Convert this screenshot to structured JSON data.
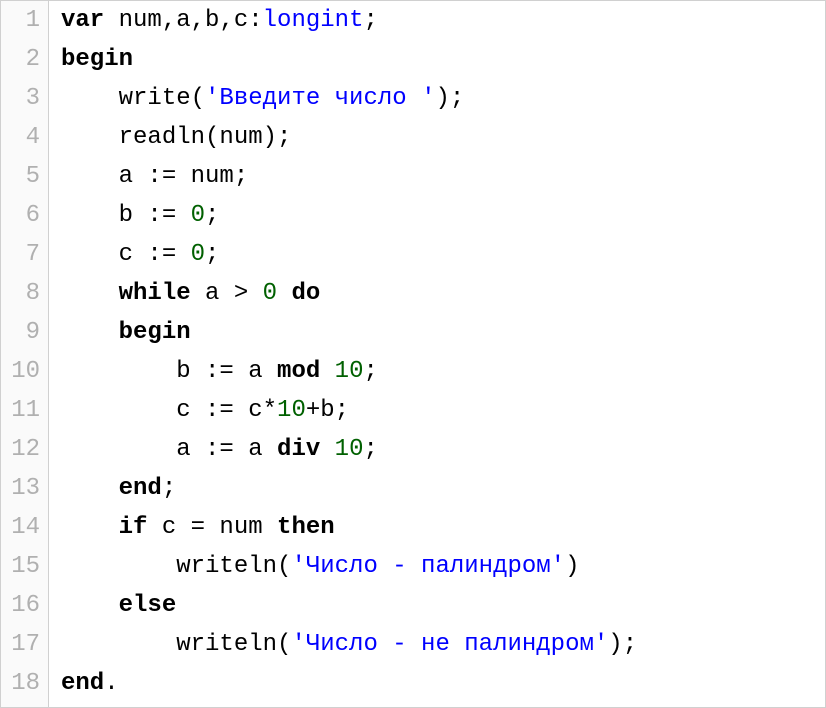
{
  "code": {
    "lines": [
      {
        "n": "1",
        "tokens": [
          {
            "cls": "kw",
            "t": "var"
          },
          {
            "cls": "pn",
            "t": " num,a,b,c:"
          },
          {
            "cls": "type",
            "t": "longint"
          },
          {
            "cls": "pn",
            "t": ";"
          }
        ],
        "indent": 0
      },
      {
        "n": "2",
        "tokens": [
          {
            "cls": "kw",
            "t": "begin"
          }
        ],
        "indent": 0
      },
      {
        "n": "3",
        "tokens": [
          {
            "cls": "pn",
            "t": "write("
          },
          {
            "cls": "str",
            "t": "'Введите число '"
          },
          {
            "cls": "pn",
            "t": ");"
          }
        ],
        "indent": 2
      },
      {
        "n": "4",
        "tokens": [
          {
            "cls": "pn",
            "t": "readln(num);"
          }
        ],
        "indent": 2
      },
      {
        "n": "5",
        "tokens": [
          {
            "cls": "pn",
            "t": "a := num;"
          }
        ],
        "indent": 2
      },
      {
        "n": "6",
        "tokens": [
          {
            "cls": "pn",
            "t": "b := "
          },
          {
            "cls": "num",
            "t": "0"
          },
          {
            "cls": "pn",
            "t": ";"
          }
        ],
        "indent": 2
      },
      {
        "n": "7",
        "tokens": [
          {
            "cls": "pn",
            "t": "c := "
          },
          {
            "cls": "num",
            "t": "0"
          },
          {
            "cls": "pn",
            "t": ";"
          }
        ],
        "indent": 2
      },
      {
        "n": "8",
        "tokens": [
          {
            "cls": "kw",
            "t": "while"
          },
          {
            "cls": "pn",
            "t": " a > "
          },
          {
            "cls": "num",
            "t": "0"
          },
          {
            "cls": "pn",
            "t": " "
          },
          {
            "cls": "kw",
            "t": "do"
          }
        ],
        "indent": 2
      },
      {
        "n": "9",
        "tokens": [
          {
            "cls": "kw",
            "t": "begin"
          }
        ],
        "indent": 2
      },
      {
        "n": "10",
        "tokens": [
          {
            "cls": "pn",
            "t": "b := a "
          },
          {
            "cls": "kw",
            "t": "mod"
          },
          {
            "cls": "pn",
            "t": " "
          },
          {
            "cls": "num",
            "t": "10"
          },
          {
            "cls": "pn",
            "t": ";"
          }
        ],
        "indent": 4
      },
      {
        "n": "11",
        "tokens": [
          {
            "cls": "pn",
            "t": "c := c*"
          },
          {
            "cls": "num",
            "t": "10"
          },
          {
            "cls": "pn",
            "t": "+b;"
          }
        ],
        "indent": 4
      },
      {
        "n": "12",
        "tokens": [
          {
            "cls": "pn",
            "t": "a := a "
          },
          {
            "cls": "kw",
            "t": "div"
          },
          {
            "cls": "pn",
            "t": " "
          },
          {
            "cls": "num",
            "t": "10"
          },
          {
            "cls": "pn",
            "t": ";"
          }
        ],
        "indent": 4
      },
      {
        "n": "13",
        "tokens": [
          {
            "cls": "kw",
            "t": "end"
          },
          {
            "cls": "pn",
            "t": ";"
          }
        ],
        "indent": 2
      },
      {
        "n": "14",
        "tokens": [
          {
            "cls": "kw",
            "t": "if"
          },
          {
            "cls": "pn",
            "t": " c = num "
          },
          {
            "cls": "kw",
            "t": "then"
          }
        ],
        "indent": 2
      },
      {
        "n": "15",
        "tokens": [
          {
            "cls": "pn",
            "t": "writeln("
          },
          {
            "cls": "str",
            "t": "'Число - палиндром'"
          },
          {
            "cls": "pn",
            "t": ")"
          }
        ],
        "indent": 4
      },
      {
        "n": "16",
        "tokens": [
          {
            "cls": "kw",
            "t": "else"
          }
        ],
        "indent": 2
      },
      {
        "n": "17",
        "tokens": [
          {
            "cls": "pn",
            "t": "writeln("
          },
          {
            "cls": "str",
            "t": "'Число - не палиндром'"
          },
          {
            "cls": "pn",
            "t": ");"
          }
        ],
        "indent": 4
      },
      {
        "n": "18",
        "tokens": [
          {
            "cls": "kw",
            "t": "end"
          },
          {
            "cls": "pn",
            "t": "."
          }
        ],
        "indent": 0
      }
    ]
  }
}
